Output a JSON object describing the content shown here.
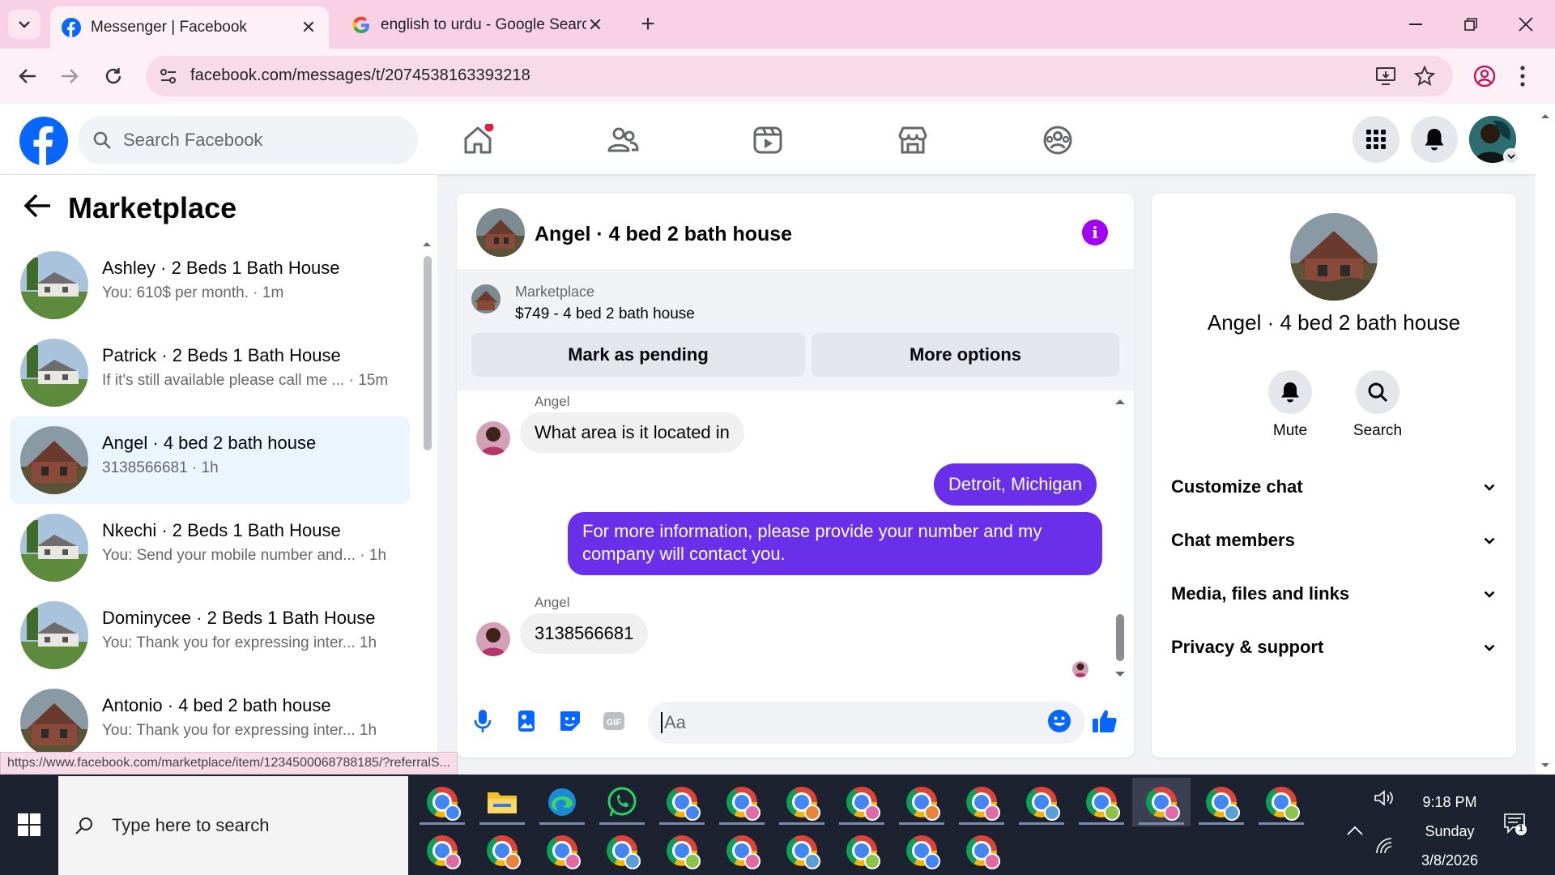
{
  "browser": {
    "tabs": [
      {
        "title": "Messenger | Facebook",
        "active": true
      },
      {
        "title": "english to urdu - Google Search",
        "active": false
      }
    ],
    "url": "facebook.com/messages/t/2074538163393218",
    "status_url": "https://www.facebook.com/marketplace/item/1234500068788185/?referralS..."
  },
  "fb_header": {
    "search_placeholder": "Search Facebook"
  },
  "left": {
    "title": "Marketplace",
    "conversations": [
      {
        "name": "Ashley · 2 Beds 1 Bath House",
        "snippet": "You: 610$ per month. · 1m",
        "thumb": "house"
      },
      {
        "name": "Patrick · 2 Beds 1 Bath House",
        "snippet": "If it's still available please call me ... · 15m",
        "thumb": "house"
      },
      {
        "name": "Angel · 4 bed 2 bath house",
        "snippet": "3138566681 · 1h",
        "thumb": "brick",
        "active": true
      },
      {
        "name": "Nkechi · 2 Beds 1 Bath House",
        "snippet": "You: Send your mobile number and... · 1h",
        "thumb": "house"
      },
      {
        "name": "Dominycee · 2 Beds 1 Bath House",
        "snippet": "You: Thank you for expressing inter...   1h",
        "thumb": "house"
      },
      {
        "name": "Antonio · 4 bed 2 bath house",
        "snippet": "You: Thank you for expressing inter...   1h",
        "thumb": "brick"
      }
    ]
  },
  "chat": {
    "title": "Angel · 4 bed 2 bath house",
    "marketplace_label": "Marketplace",
    "listing": "$749 - 4 bed 2 bath house",
    "mark_pending": "Mark as pending",
    "more_options": "More options",
    "messages": [
      {
        "sender": "Angel",
        "text": "What area is it located in",
        "dir": "in"
      },
      {
        "text": "Detroit, Michigan",
        "dir": "out"
      },
      {
        "text": "For more information, please provide your number and my company will contact you.",
        "dir": "out"
      },
      {
        "sender": "Angel",
        "text": "3138566681",
        "dir": "in"
      }
    ],
    "composer_placeholder": "Aa"
  },
  "right": {
    "name": "Angel · 4 bed 2 bath house",
    "mute": "Mute",
    "search": "Search",
    "rows": [
      "Customize chat",
      "Chat members",
      "Media, files and links",
      "Privacy & support"
    ]
  },
  "taskbar": {
    "search_placeholder": "Type here to search",
    "time": "9:18 PM",
    "day": "Sunday",
    "date": "3/8/2026",
    "notification_count": "1"
  },
  "colors": {
    "fb_blue": "#0866ff",
    "outgoing_bubble": "#6a2fe8",
    "chrome_tabbar": "#f8d2e4"
  }
}
